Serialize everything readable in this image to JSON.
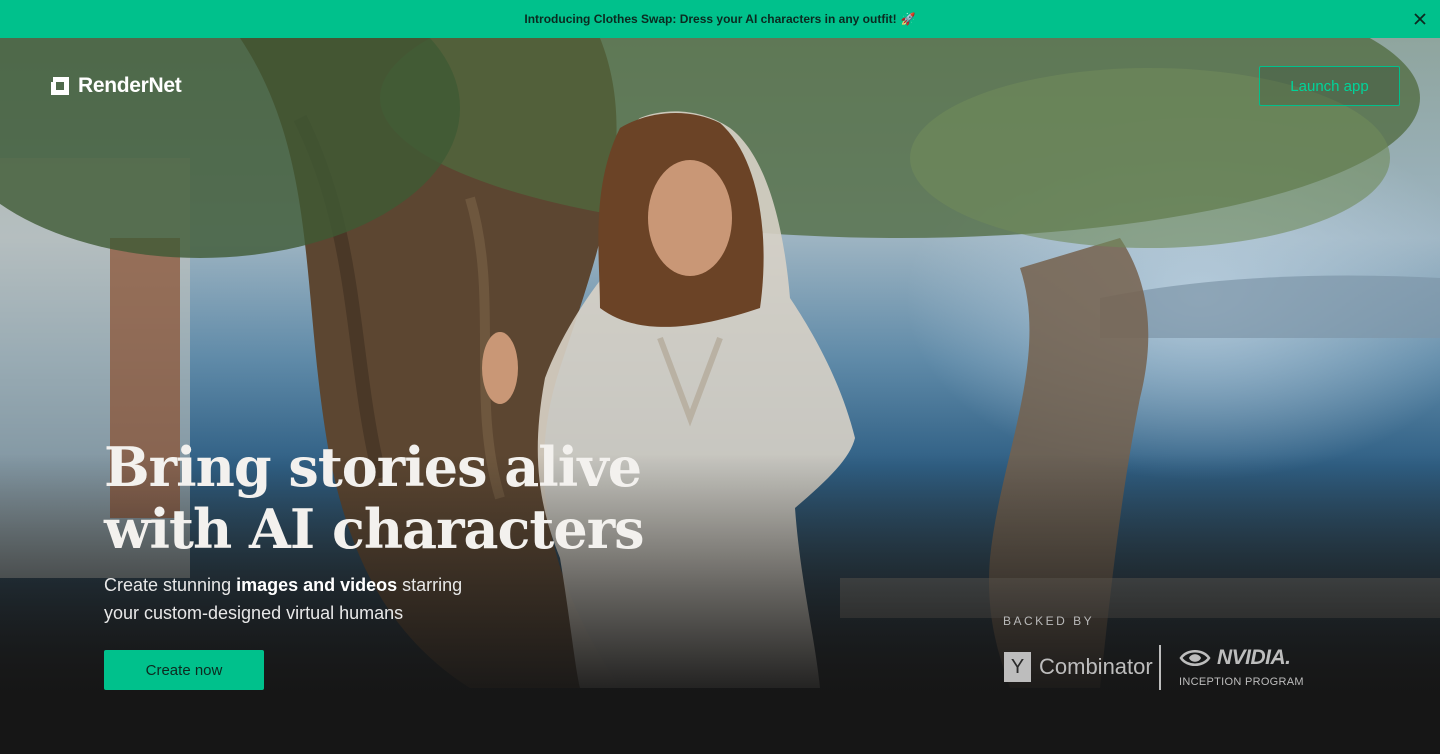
{
  "announcement": {
    "text": "Introducing Clothes Swap: Dress your AI characters in any outfit!",
    "emoji": "🚀",
    "close_icon": "close-icon"
  },
  "nav": {
    "brand": "RenderNet",
    "logo_icon": "rendernet-logo-icon",
    "launch_label": "Launch app"
  },
  "hero": {
    "headline_line1": "Bring stories alive",
    "headline_line2": "with AI characters",
    "sub_prefix": "Create stunning ",
    "sub_bold": "images and videos",
    "sub_suffix": " starring",
    "sub_line2": "your custom-designed virtual humans",
    "cta_label": "Create now"
  },
  "backers": {
    "label": "BACKED BY",
    "yc_letter": "Y",
    "yc_word": "Combinator",
    "nvidia_word": "NVIDIA.",
    "nvidia_sub": "INCEPTION PROGRAM"
  },
  "colors": {
    "accent": "#00c18c",
    "background": "#161616"
  }
}
